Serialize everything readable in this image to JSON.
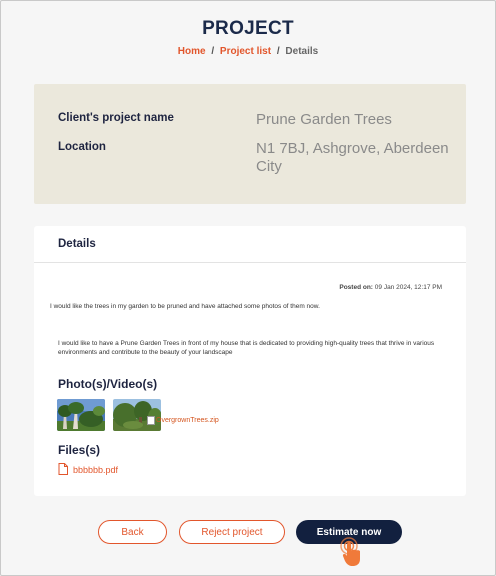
{
  "header": {
    "title": "PROJECT",
    "breadcrumb": {
      "home": "Home",
      "list": "Project list",
      "current": "Details",
      "separator": "/"
    }
  },
  "project": {
    "name_label": "Client's project name",
    "name_value": "Prune Garden Trees",
    "location_label": "Location",
    "location_value": "N1 7BJ, Ashgrove, Aberdeen City"
  },
  "details": {
    "heading": "Details",
    "posted_label": "Posted on:",
    "posted_value": "09 Jan 2024, 12:17 PM",
    "description_short": "I would like the trees in my garden to be pruned and have attached some photos of them now.",
    "description_long": "I would like to have a Prune Garden Trees in front of my house that is dedicated to providing high-quality trees that thrive in various environments and contribute to the beauty of your landscape",
    "media_heading": "Photo(s)/Video(s)",
    "media_zip": "OvergrownTrees.zip",
    "files_heading": "Files(s)",
    "file_name": "bbbbbb.pdf"
  },
  "actions": {
    "back": "Back",
    "reject": "Reject project",
    "estimate": "Estimate now"
  },
  "colors": {
    "accent": "#e2562c",
    "navy": "#12203f",
    "info_bg": "#ebe8dc"
  }
}
